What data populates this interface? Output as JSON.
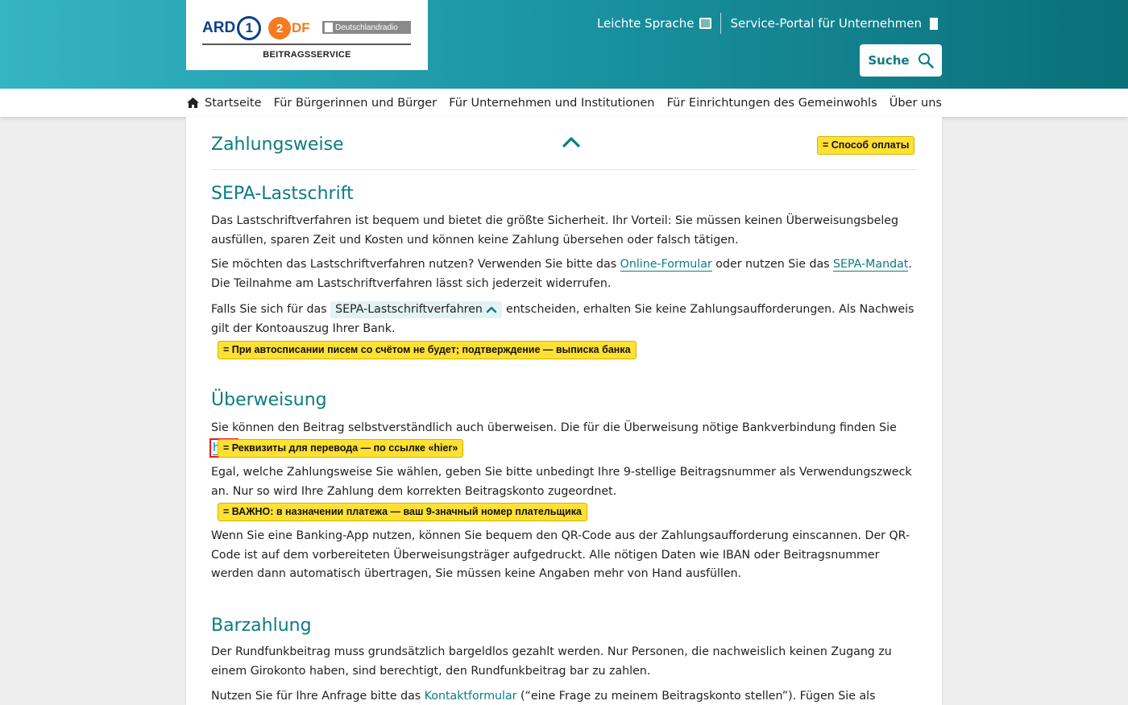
{
  "header": {
    "logos": {
      "ard": "ARD",
      "ard_number": "1",
      "zdf": "ZDF",
      "zdf_circle": "2",
      "zdf_rest": "DF",
      "dradio": "Deutschlandradio",
      "subtitle": "BEITRAGSSERVICE"
    },
    "links": {
      "easy_language": "Leichte Sprache",
      "easy_language_icon": "book-icon",
      "business_portal": "Service-Portal für Unternehmen",
      "business_portal_icon": "door-icon"
    },
    "search_label": "Suche",
    "search_icon": "search-icon",
    "gradient_colors": [
      "#35b4c2",
      "#0a6f78"
    ]
  },
  "nav": {
    "items": [
      {
        "label": "Startseite",
        "icon": "home-icon"
      },
      {
        "label": "Für Bürgerinnen und Bürger"
      },
      {
        "label": "Für Unternehmen und Institutionen"
      },
      {
        "label": "Für Einrichtungen des Gemeinwohls"
      },
      {
        "label": "Über uns"
      }
    ]
  },
  "accordion": {
    "title": "Zahlungsweise",
    "chevron_icon": "chevron-up-icon",
    "badge": "= Способ оплаты"
  },
  "sepa": {
    "heading": "SEPA-Lastschrift",
    "p1": "Das Lastschriftverfahren ist bequem und bietet die größte Sicherheit. Ihr Vorteil: Sie müssen keinen Überweisungsbeleg ausfüllen, sparen Zeit und Kosten und können keine Zahlung übersehen oder falsch tätigen.",
    "p2_before": "Sie möchten das Lastschriftverfahren nutzen? Verwenden Sie bitte das ",
    "p2_link1": "Online-Formular",
    "p2_mid": " oder nutzen Sie das ",
    "p2_link2": "SEPA-Mandat",
    "p2_after": ". Die Teil­nahme am Lastschriftverfahren lässt sich jederzeit widerrufen.",
    "p3_before": "Falls Sie sich für das ",
    "p3_pill": "SEPA-Lastschriftverfahren",
    "p3_after": " entscheiden, erhalten Sie keine Zahlungsaufforderungen. Als Nachweis gilt der Kontoauszug Ihrer Bank.",
    "badge": "= При автосписании писем со счётом не будет; подтверждение — выписка банка"
  },
  "transfer": {
    "heading": "Überweisung",
    "p1_before": "Sie können den Beitrag selbstverständlich auch überweisen. Die für die Überweisung nötige Bankverbindung finden Sie ",
    "p1_link": "hier",
    "p1_after": ".",
    "badge1": "= Реквизиты для перевода — по ссылке «hier»",
    "p2": "Egal, welche Zahlungsweise Sie wählen, geben Sie bitte unbedingt Ihre 9-stellige Beitragsnummer als Verwendungszweck an. Nur so wird Ihre Zahlung dem korrekten Beitragskonto zugeordnet.",
    "badge2": "= ВАЖНО: в назначении платежа — ваш 9-значный номер плательщика",
    "p3": "Wenn Sie eine Banking-App nutzen, können Sie bequem den QR-Code aus der Zahlungsaufforderung einscannen. Der QR-Code ist auf dem vorbereiteten Überweisungsträger aufgedruckt. Alle nötigen Daten wie IBAN oder Beitragsnummer werden dann automatisch übertragen, Sie müssen keine Angaben mehr von Hand ausfüllen."
  },
  "cash": {
    "heading": "Barzahlung",
    "p1": "Der Rundfunkbeitrag muss grundsätzlich bargeldlos gezahlt werden. Nur Personen, die nachweislich keinen Zugang zu einem Giro­konto haben, sind berechtigt, den Rundfunkbeitrag bar zu zahlen.",
    "p2_before": "Nutzen Sie für Ihre Anfrage bitte das ",
    "p2_link": "Kontaktformular",
    "p2_after": " (“eine Frage zu meinem Beitragskonto stellen”). Fügen Sie als Nachweise min-"
  },
  "colors": {
    "accent": "#0a7c84",
    "badge_bg": "#ffe033",
    "highlight_border": "#e11d1d"
  }
}
